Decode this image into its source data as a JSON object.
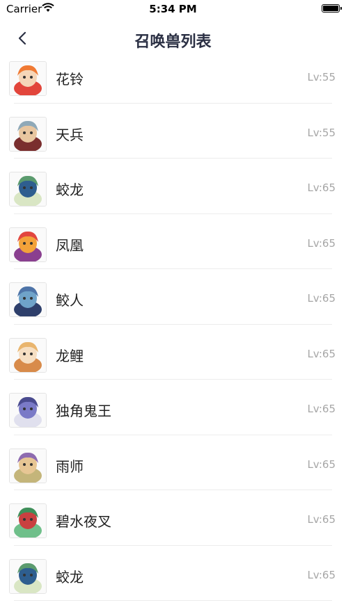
{
  "status_bar": {
    "carrier": "Carrier",
    "time": "5:34 PM"
  },
  "nav": {
    "title": "召唤兽列表",
    "back_icon": "chevron-left-icon"
  },
  "pets": [
    {
      "name": "花铃",
      "level": "Lv:55",
      "colors": [
        "#f07a34",
        "#f5d6b8",
        "#e2453b"
      ]
    },
    {
      "name": "天兵",
      "level": "Lv:55",
      "colors": [
        "#8fa9b8",
        "#e8c6a0",
        "#7a2e2e"
      ]
    },
    {
      "name": "蛟龙",
      "level": "Lv:65",
      "colors": [
        "#5b9b6e",
        "#2e5e8f",
        "#d9e6c4"
      ]
    },
    {
      "name": "凤凰",
      "level": "Lv:65",
      "colors": [
        "#e2463f",
        "#f3a23a",
        "#8a3f8f"
      ]
    },
    {
      "name": "鲛人",
      "level": "Lv:65",
      "colors": [
        "#4e74a8",
        "#6fa3c9",
        "#2e3f6b"
      ]
    },
    {
      "name": "龙鲤",
      "level": "Lv:65",
      "colors": [
        "#e9b56e",
        "#f6dfc3",
        "#d88b4a"
      ]
    },
    {
      "name": "独角鬼王",
      "level": "Lv:65",
      "colors": [
        "#4a4b8f",
        "#7a7ac7",
        "#e0e0ee"
      ]
    },
    {
      "name": "雨师",
      "level": "Lv:65",
      "colors": [
        "#8e6bb0",
        "#e7c694",
        "#c4b57a"
      ]
    },
    {
      "name": "碧水夜叉",
      "level": "Lv:65",
      "colors": [
        "#3f8f5a",
        "#c94040",
        "#6fbf8a"
      ]
    },
    {
      "name": "蛟龙",
      "level": "Lv:65",
      "colors": [
        "#5b9b6e",
        "#2e5e8f",
        "#d9e6c4"
      ]
    }
  ]
}
